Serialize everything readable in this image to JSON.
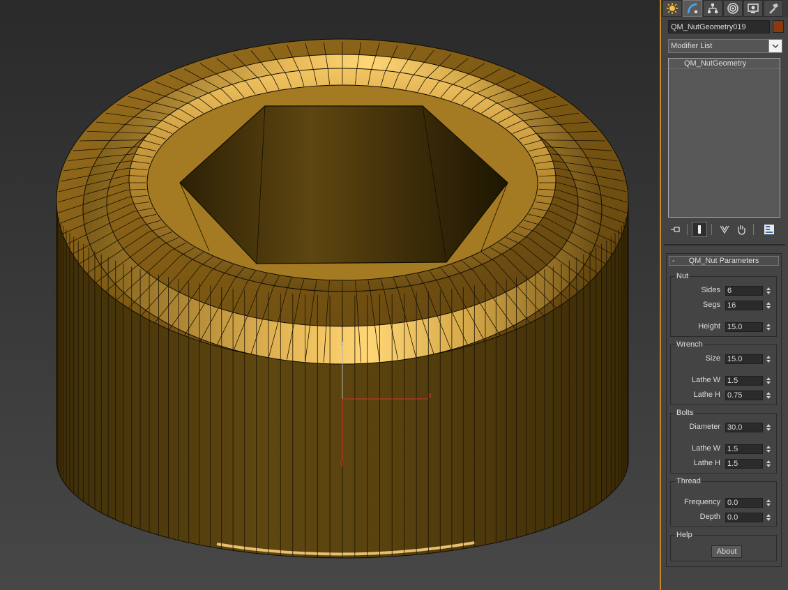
{
  "panel": {
    "tabs": [
      {
        "name": "create-tab-icon"
      },
      {
        "name": "modify-tab-icon"
      },
      {
        "name": "hierarchy-tab-icon"
      },
      {
        "name": "motion-tab-icon"
      },
      {
        "name": "display-tab-icon"
      },
      {
        "name": "utilities-tab-icon"
      }
    ],
    "active_tab": 1,
    "object_name": "QM_NutGeometry019",
    "object_color": "#8b3a0e",
    "modifier_list_label": "Modifier List",
    "stack_items": [
      "QM_NutGeometry"
    ],
    "stack_tools": [
      "pin-stack-icon",
      "show-end-result-icon",
      "make-unique-icon",
      "remove-modifier-icon",
      "configure-modifier-sets-icon"
    ],
    "rollout": {
      "collapse_symbol": "-",
      "title": "QM_Nut Parameters",
      "nut": {
        "title": "Nut",
        "sides_label": "Sides",
        "sides": "6",
        "segs_label": "Segs",
        "segs": "16",
        "height_label": "Height",
        "height": "15.0"
      },
      "wrench": {
        "title": "Wrench",
        "size_label": "Size",
        "size": "15.0",
        "lathe_w_label": "Lathe W",
        "lathe_w": "1.5",
        "lathe_h_label": "Lathe H",
        "lathe_h": "0.75"
      },
      "bolts": {
        "title": "Bolts",
        "diameter_label": "Diameter",
        "diameter": "30.0",
        "lathe_w_label": "Lathe W",
        "lathe_w": "1.5",
        "lathe_h_label": "Lathe H",
        "lathe_h": "1.5"
      },
      "thread": {
        "title": "Thread",
        "frequency_label": "Frequency",
        "frequency": "0.0",
        "depth_label": "Depth",
        "depth": "0.0"
      },
      "help": {
        "title": "Help",
        "about_label": "About"
      }
    }
  },
  "viewport": {
    "gizmo": {
      "x_label": "x",
      "y_label": "y",
      "z_label": "z"
    },
    "colors": {
      "body": "#5e4610",
      "top_ring": "#8a6415",
      "inner_ring": "#ddb157",
      "bright_band": "#f7cd66",
      "bore": "#3a2b07",
      "x_axis": "#d63030",
      "y_axis": "#d63030",
      "z_axis": "#b0b0b0",
      "highlight_border": "#c88a1e"
    }
  }
}
